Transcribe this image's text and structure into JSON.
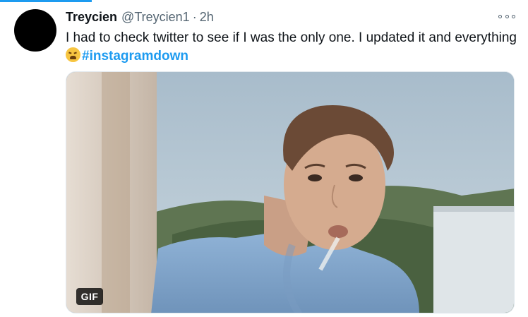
{
  "tweet": {
    "name": "Treycien",
    "handle": "@Treycien1",
    "separator": "·",
    "time": "2h",
    "text": "I had to check twitter to see if I was the only one. I updated it and everything",
    "emoji": "tired-face-emoji",
    "hashtag": "#instagramdown",
    "media": {
      "badge": "GIF"
    }
  },
  "colors": {
    "accent": "#1d9bf0",
    "secondary_text": "#536471",
    "primary_text": "#0f1419"
  }
}
